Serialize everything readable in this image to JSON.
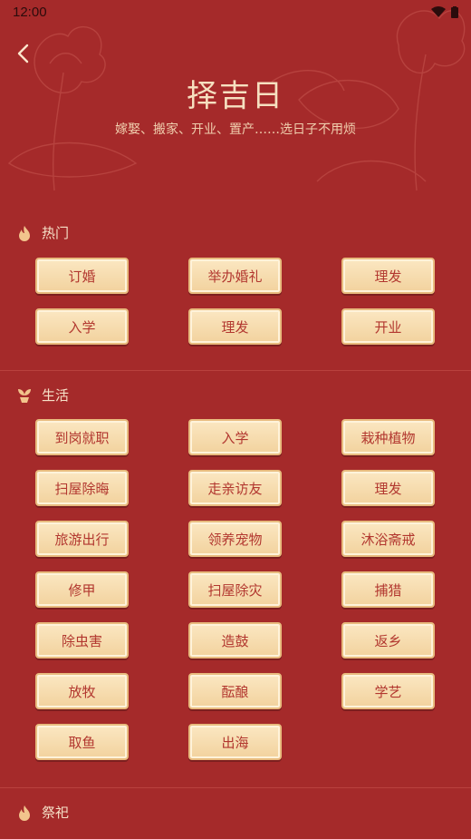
{
  "status_bar": {
    "time": "12:00"
  },
  "header": {
    "title": "择吉日",
    "subtitle": "嫁娶、搬家、开业、置产……选日子不用烦"
  },
  "sections": [
    {
      "title": "热门",
      "icon": "flame-icon",
      "items": [
        "订婚",
        "举办婚礼",
        "理发",
        "入学",
        "理发",
        "开业"
      ]
    },
    {
      "title": "生活",
      "icon": "sprout-icon",
      "items": [
        "到岗就职",
        "入学",
        "栽种植物",
        "扫屋除晦",
        "走亲访友",
        "理发",
        "旅游出行",
        "领养宠物",
        "沐浴斋戒",
        "修甲",
        "扫屋除灾",
        "捕猎",
        "除虫害",
        "造鼓",
        "返乡",
        "放牧",
        "酝酿",
        "学艺",
        "取鱼",
        "出海"
      ]
    },
    {
      "title": "祭祀",
      "icon": "flame-icon",
      "items": []
    }
  ],
  "colors": {
    "background": "#a52a2a",
    "button_face": "#f6dcae",
    "button_text": "#b2372f"
  }
}
